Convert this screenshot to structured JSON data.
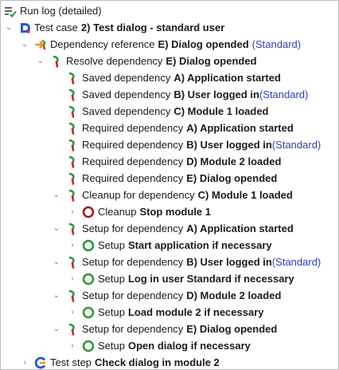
{
  "colors": {
    "dep_green": "#2a9a3a",
    "dep_red": "#c62828",
    "link_blue": "#2a3fc7",
    "cleanup_red": "#a31919",
    "setup_green": "#2a9a3a"
  },
  "icons": {
    "root": "run-log-icon",
    "testcase": "test-case-icon",
    "depref": "dependency-reference-icon",
    "dep": "dependency-icon",
    "cleanup": "cleanup-circle-icon",
    "setup": "setup-circle-icon",
    "teststep": "test-step-icon"
  },
  "tree": {
    "root": {
      "label": "Run log (detailed)"
    },
    "testcase": {
      "prefix": "Test case",
      "name": "2) Test dialog - standard user"
    },
    "depref": {
      "prefix": "Dependency reference",
      "name": "E) Dialog opended",
      "tag": "(Standard)"
    },
    "resolve": {
      "prefix": "Resolve dependency",
      "name": "E) Dialog opended"
    },
    "saved": [
      {
        "prefix": "Saved dependency",
        "name": "A) Application started"
      },
      {
        "prefix": "Saved dependency",
        "name": "B) User logged in",
        "tag": "(Standard)"
      },
      {
        "prefix": "Saved dependency",
        "name": "C) Module 1 loaded"
      }
    ],
    "required": [
      {
        "prefix": "Required dependency",
        "name": "A) Application started"
      },
      {
        "prefix": "Required dependency",
        "name": "B) User logged in",
        "tag": "(Standard)"
      },
      {
        "prefix": "Required dependency",
        "name": "D) Module 2 loaded"
      },
      {
        "prefix": "Required dependency",
        "name": "E) Dialog opended"
      }
    ],
    "cleanup_dep": {
      "prefix": "Cleanup for dependency",
      "name": "C) Module 1 loaded"
    },
    "cleanup_step": {
      "prefix": "Cleanup",
      "name": "Stop module 1"
    },
    "setups": [
      {
        "prefix": "Setup for dependency",
        "name": "A) Application started",
        "step_prefix": "Setup",
        "step_name": "Start application if necessary"
      },
      {
        "prefix": "Setup for dependency",
        "name": "B) User logged in",
        "tag": "(Standard)",
        "step_prefix": "Setup",
        "step_name": "Log in user Standard if necessary"
      },
      {
        "prefix": "Setup for dependency",
        "name": "D) Module 2 loaded",
        "step_prefix": "Setup",
        "step_name": "Load module 2 if necessary"
      },
      {
        "prefix": "Setup for dependency",
        "name": "E) Dialog opended",
        "step_prefix": "Setup",
        "step_name": "Open dialog if necessary"
      }
    ],
    "teststep": {
      "prefix": "Test step",
      "name": "Check dialog in module 2"
    }
  }
}
